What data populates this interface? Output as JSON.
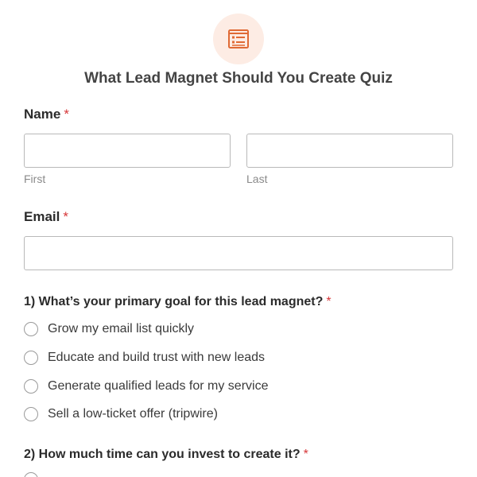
{
  "form": {
    "icon": "form-list-icon",
    "accent_color": "#e06a35",
    "title": "What Lead Magnet Should You Create Quiz"
  },
  "name_field": {
    "label": "Name",
    "required_mark": "*",
    "first": {
      "value": "",
      "sublabel": "First"
    },
    "last": {
      "value": "",
      "sublabel": "Last"
    }
  },
  "email_field": {
    "label": "Email",
    "required_mark": "*",
    "value": ""
  },
  "question1": {
    "label": "1) What’s your primary goal for this lead magnet?",
    "required_mark": "*",
    "options": [
      "Grow my email list quickly",
      "Educate and build trust with new leads",
      "Generate qualified leads for my service",
      "Sell a low-ticket offer (tripwire)"
    ]
  },
  "question2": {
    "label": "2) How much time can you invest to create it?",
    "required_mark": "*"
  }
}
